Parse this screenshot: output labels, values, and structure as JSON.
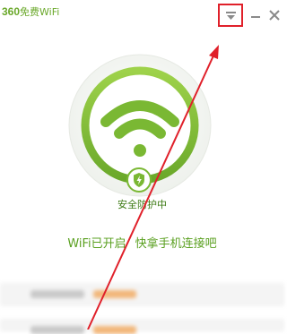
{
  "app": {
    "title_number": "360",
    "title_text": "免费WiFi"
  },
  "window": {
    "menu_icon": "chevron-down-icon",
    "minimize_icon": "minimize-icon",
    "close_icon": "close-icon"
  },
  "status": {
    "label": "安全防护中",
    "icon": "shield-icon"
  },
  "message": {
    "wifi_status": "WiFi已开启",
    "prompt": "快拿手机连接吧"
  },
  "colors": {
    "brand_green": "#7ab833",
    "text_green": "#5aa020",
    "annotation_red": "#e0202a"
  }
}
